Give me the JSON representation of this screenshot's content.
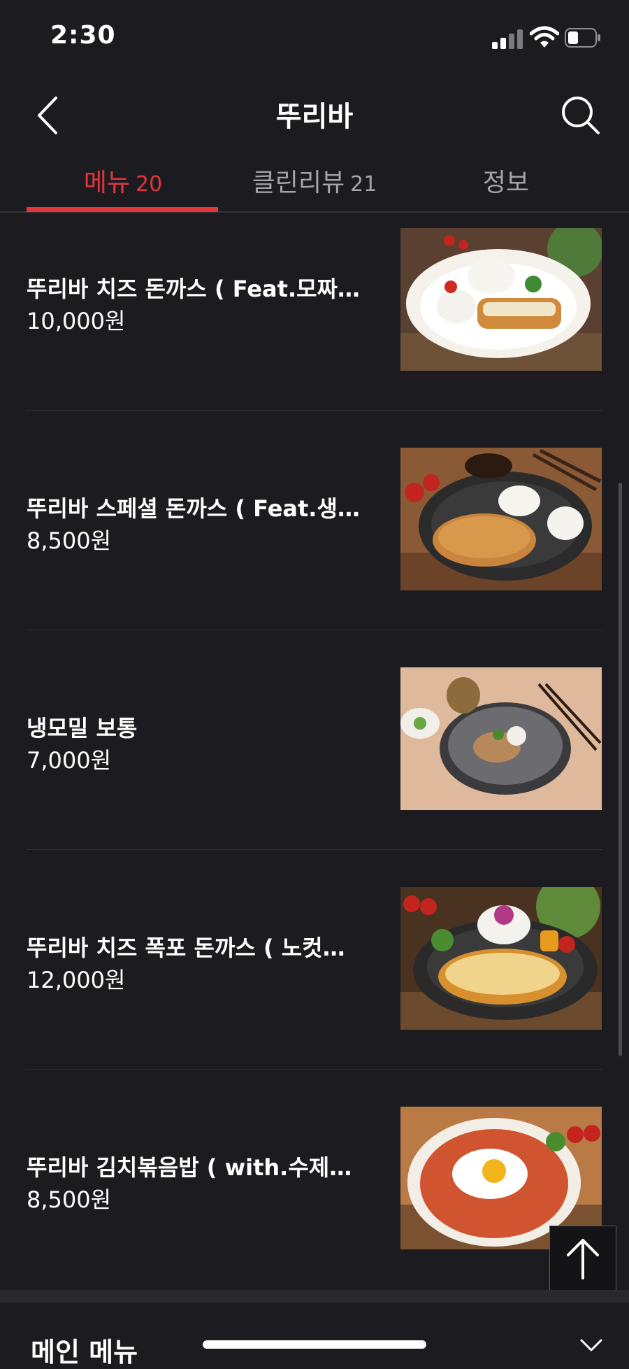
{
  "status_bar": {
    "time": "2:30"
  },
  "header": {
    "title": "뚜리바",
    "back_icon": "chevron-left-icon",
    "search_icon": "search-icon"
  },
  "tabs": [
    {
      "label": "메뉴",
      "count": "20",
      "active": true
    },
    {
      "label": "클린리뷰",
      "count": "21",
      "active": false
    },
    {
      "label": "정보",
      "count": "",
      "active": false
    }
  ],
  "menu": {
    "items": [
      {
        "name": "뚜리바 치즈 돈까스 ( Feat.모짜…",
        "price": "10,000원",
        "image": "cheese-tonkatsu-plate"
      },
      {
        "name": "뚜리바 스페셜 돈까스 ( Feat.생…",
        "price": "8,500원",
        "image": "special-tonkatsu-plate"
      },
      {
        "name": "냉모밀 보통",
        "price": "7,000원",
        "image": "cold-buckwheat-noodle-bowl"
      },
      {
        "name": "뚜리바 치즈 폭포 돈까스 ( 노컷…",
        "price": "12,000원",
        "image": "cheese-waterfall-tonkatsu-plate"
      },
      {
        "name": "뚜리바 김치볶음밥 ( with.수제…",
        "price": "8,500원",
        "image": "kimchi-fried-rice-plate"
      }
    ]
  },
  "bottom_bar": {
    "label": "메인 메뉴",
    "icon": "chevron-down-icon"
  },
  "scroll_top_icon": "arrow-up-icon",
  "colors": {
    "background": "#1c1c20",
    "accent": "#e4353d",
    "muted_text": "#a3a3a8"
  }
}
